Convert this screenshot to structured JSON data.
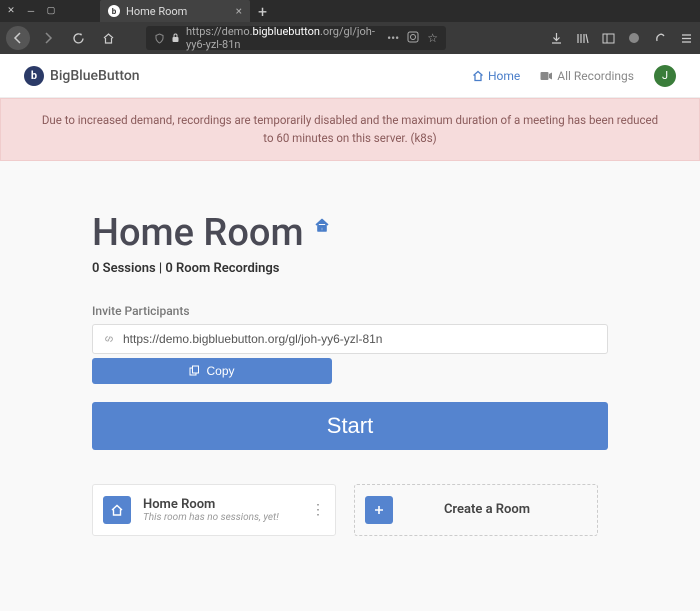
{
  "browser": {
    "tab_title": "Home Room",
    "url_prefix": "https://demo.",
    "url_host": "bigbluebutton",
    "url_suffix": ".org/gl/joh-yy6-yzl-81n"
  },
  "navbar": {
    "brand": "BigBlueButton",
    "home_label": "Home",
    "recordings_label": "All Recordings",
    "avatar_initial": "J"
  },
  "alert": {
    "text": "Due to increased demand, recordings are temporarily disabled and the maximum duration of a meeting has been reduced to 60 minutes on this server. (k8s)"
  },
  "room": {
    "title": "Home Room",
    "subtitle": "0 Sessions | 0 Room Recordings",
    "invite_label": "Invite Participants",
    "invite_url": "https://demo.bigbluebutton.org/gl/joh-yy6-yzl-81n",
    "copy_label": "Copy",
    "start_label": "Start"
  },
  "rooms": {
    "home": {
      "name": "Home Room",
      "sub": "This room has no sessions, yet!"
    },
    "create_label": "Create a Room"
  }
}
